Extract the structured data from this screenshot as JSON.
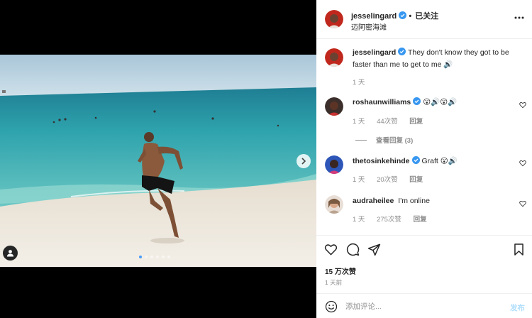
{
  "post": {
    "username": "jesselingard",
    "follow_label": "已关注",
    "separator": "•",
    "location": "迈阿密海滩",
    "caption": "They don't know they got to be faster than me to get to me",
    "caption_emoji": "🔊",
    "caption_time": "1 天"
  },
  "comments": [
    {
      "username": "roshaunwilliams",
      "text": "😮🔊😮🔊",
      "time": "1 天",
      "likes": "44次赞",
      "reply_label": "回复",
      "view_replies": "查看回复 (3)"
    },
    {
      "username": "thetosinkehinde",
      "text": "Graft 😮🔊",
      "time": "1 天",
      "likes": "20次赞",
      "reply_label": "回复"
    },
    {
      "username": "audraheilee",
      "text": "I'm online",
      "time": "1 天",
      "likes": "275次赞",
      "reply_label": "回复"
    }
  ],
  "stats": {
    "likes": "15 万次赞",
    "time": "1 天前"
  },
  "comment_box": {
    "placeholder": "添加评论...",
    "post_label": "发布"
  },
  "carousel": {
    "total": 6,
    "active": 0
  },
  "icons": [
    "verified-badge",
    "more-icon",
    "heart-icon",
    "comment-icon",
    "share-icon",
    "bookmark-icon",
    "emoji-icon",
    "chevron-right-icon",
    "user-tag-icon"
  ],
  "colors": {
    "verified": "#3897f0",
    "muted": "#8e8e8e",
    "post_button": "#b2dffc",
    "dot_active": "#4a9df8"
  }
}
